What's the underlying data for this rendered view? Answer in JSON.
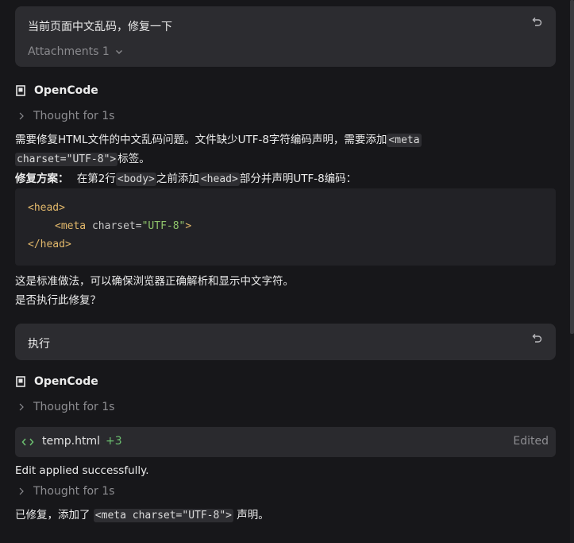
{
  "messages": {
    "user1": {
      "text": "当前页面中文乱码，修复一下",
      "attachments_label": "Attachments 1"
    },
    "agent1": {
      "name": "OpenCode",
      "thought": "Thought for 1s",
      "p1_part1": "需要修复HTML文件的中文乱码问题。文件缺少UTF-8字符编码声明，需要添加",
      "p1_code": "<meta",
      "p1_line2_code": "charset=\"UTF-8\">",
      "p1_line2_tail": "标签。",
      "fix_label": "修复方案：",
      "fix_part1": "在第2行",
      "fix_code1": "<body>",
      "fix_part2": "之前添加",
      "fix_code2": "<head>",
      "fix_part3": "部分并声明UTF-8编码：",
      "code_block": {
        "line1": "<head>",
        "line2_tag": "<meta",
        "line2_attr": " charset=",
        "line2_str": "\"UTF-8\"",
        "line2_close": ">",
        "line3": "</head>"
      },
      "closing1": "这是标准做法，可以确保浏览器正确解析和显示中文字符。",
      "closing2": "是否执行此修复？"
    },
    "user2": {
      "text": "执行"
    },
    "agent2": {
      "name": "OpenCode",
      "thought1": "Thought for 1s",
      "edit": {
        "filename": "temp.html",
        "diff": "+3",
        "status": "Edited"
      },
      "result": "Edit applied successfully.",
      "thought2": "Thought for 1s",
      "final_part1": "已修复，添加了 ",
      "final_code": "<meta charset=\"UTF-8\">",
      "final_part2": " 声明。"
    }
  },
  "colors": {
    "background": "#17171a",
    "user_bubble": "#2c2c30",
    "code_tag": "#e2b86b",
    "code_string": "#8fc46b",
    "diff_add": "#6cc070"
  },
  "icons": {
    "undo": "undo-icon",
    "chevron_down": "chevron-down-icon",
    "chevron_right": "chevron-right-icon",
    "agent": "opencode-logo-icon",
    "file_code": "code-icon"
  }
}
